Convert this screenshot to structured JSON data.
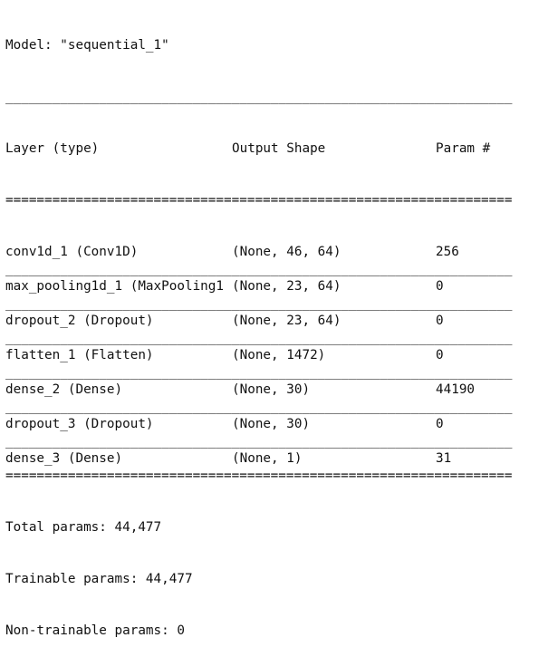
{
  "model_title": "Model: \"sequential_1\"",
  "columns": [
    "Layer (type)",
    "Output Shape",
    "Param #"
  ],
  "layers": [
    {
      "layer": "conv1d_1 (Conv1D)",
      "shape": "(None, 46, 64)",
      "params": "256"
    },
    {
      "layer": "max_pooling1d_1 (MaxPooling1",
      "shape": "(None, 23, 64)",
      "params": "0"
    },
    {
      "layer": "dropout_2 (Dropout)",
      "shape": "(None, 23, 64)",
      "params": "0"
    },
    {
      "layer": "flatten_1 (Flatten)",
      "shape": "(None, 1472)",
      "params": "0"
    },
    {
      "layer": "dense_2 (Dense)",
      "shape": "(None, 30)",
      "params": "44190"
    },
    {
      "layer": "dropout_3 (Dropout)",
      "shape": "(None, 30)",
      "params": "0"
    },
    {
      "layer": "dense_3 (Dense)",
      "shape": "(None, 1)",
      "params": "31"
    }
  ],
  "totals": {
    "total": "Total params: 44,477",
    "trainable": "Trainable params: 44,477",
    "non_trainable": "Non-trainable params: 0"
  }
}
